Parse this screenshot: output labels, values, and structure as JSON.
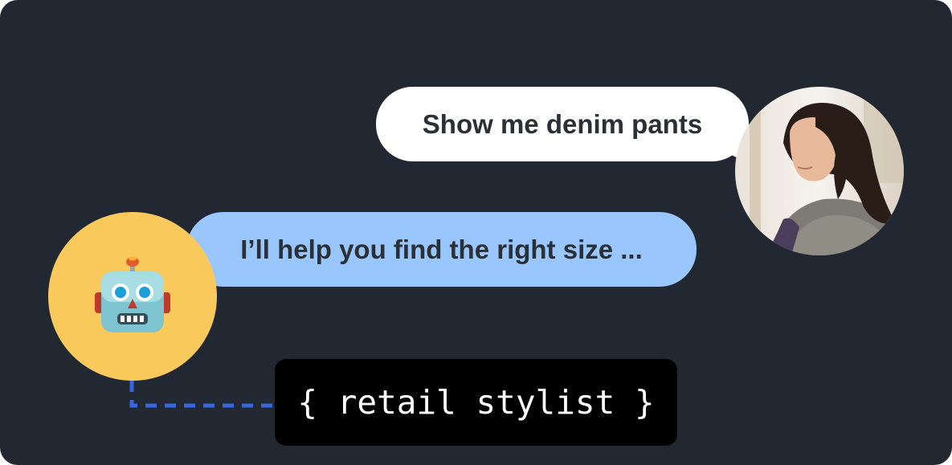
{
  "user_message": {
    "text": "Show me denim pants"
  },
  "bot_message": {
    "text": "I’ll help you find the right size ..."
  },
  "role_label": {
    "text": "{ retail stylist }"
  },
  "icons": {
    "user_avatar": "person-photo-avatar",
    "bot_avatar": "robot-icon"
  },
  "colors": {
    "background": "#222831",
    "user_bubble": "#ffffff",
    "bot_bubble": "#99c7fd",
    "bot_avatar_bg": "#fac95c",
    "connector": "#3565e0",
    "role_box": "#000000"
  }
}
